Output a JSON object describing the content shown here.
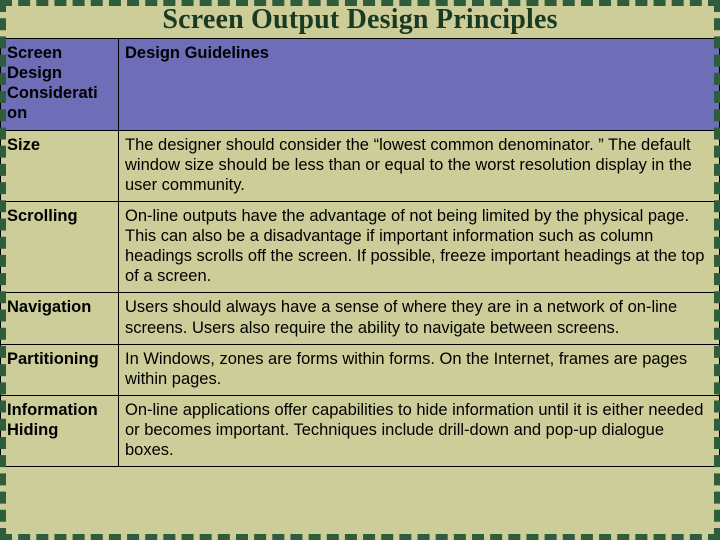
{
  "title": "Screen Output Design Principles",
  "headers": {
    "col0": "Screen Design Considerati on",
    "col1": "Design Guidelines"
  },
  "rows": [
    {
      "label": "Size",
      "body": "The designer should consider the “lowest common denominator. ” The default window size should be less than or equal to the worst resolution display in the user community."
    },
    {
      "label": "Scrolling",
      "body": "On-line outputs have the advantage of not being limited by the physical page. This can also be a disadvantage if important information such as column headings scrolls off the screen. If possible, freeze important headings at the top of a screen."
    },
    {
      "label": "Navigation",
      "body": "Users should always have a sense of where they are in a network of on-line screens. Users also require the ability to navigate between screens."
    },
    {
      "label": "Partitioning",
      "body": "In Windows, zones are forms within forms. On the Internet, frames are pages within pages."
    },
    {
      "label": "Information Hiding",
      "body": "On-line applications offer capabilities to hide information until it is either needed or becomes important. Techniques include drill-down and pop-up dialogue boxes."
    }
  ]
}
